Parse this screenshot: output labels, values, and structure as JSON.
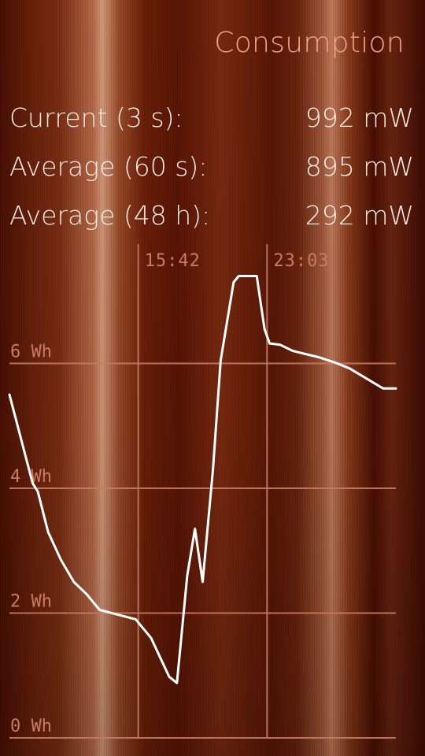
{
  "header": {
    "title": "Consumption"
  },
  "stats": [
    {
      "label": "Current (3 s):",
      "value": "992 mW"
    },
    {
      "label": "Average (60 s):",
      "value": "895 mW"
    },
    {
      "label": "Average (48 h):",
      "value": "292 mW"
    }
  ],
  "chart_data": {
    "type": "line",
    "title": "",
    "xlabel": "",
    "ylabel": "",
    "y_unit": "Wh",
    "ylim": [
      0,
      8
    ],
    "yticks": [
      0,
      2,
      4,
      6
    ],
    "ytick_labels": [
      "0 Wh",
      "2 Wh",
      "4 Wh",
      "6 Wh"
    ],
    "x_markers": [
      {
        "label": "15:42",
        "at": 5.0
      },
      {
        "label": "23:03",
        "at": 10.0
      }
    ],
    "xlim": [
      0,
      15
    ],
    "grid": true,
    "series": [
      {
        "color": "#ffffff",
        "points": [
          [
            0.0,
            5.5
          ],
          [
            0.9,
            4.08
          ],
          [
            1.1,
            3.95
          ],
          [
            1.5,
            3.3
          ],
          [
            2.0,
            2.85
          ],
          [
            2.5,
            2.5
          ],
          [
            3.0,
            2.3
          ],
          [
            3.5,
            2.05
          ],
          [
            4.9,
            1.9
          ],
          [
            5.5,
            1.6
          ],
          [
            6.2,
            0.98
          ],
          [
            6.5,
            0.88
          ],
          [
            6.9,
            2.6
          ],
          [
            7.2,
            3.35
          ],
          [
            7.5,
            2.5
          ],
          [
            7.9,
            4.3
          ],
          [
            8.2,
            6.05
          ],
          [
            8.7,
            7.3
          ],
          [
            8.9,
            7.4
          ],
          [
            9.6,
            7.4
          ],
          [
            9.9,
            6.55
          ],
          [
            10.1,
            6.32
          ],
          [
            10.5,
            6.3
          ],
          [
            11.0,
            6.2
          ],
          [
            12.0,
            6.1
          ],
          [
            12.6,
            6.02
          ],
          [
            13.2,
            5.92
          ],
          [
            14.5,
            5.6
          ],
          [
            15.0,
            5.6
          ]
        ]
      }
    ]
  },
  "colors": {
    "accent": "#f2a58a",
    "grid": "#c87a62",
    "line": "#ffffff"
  }
}
